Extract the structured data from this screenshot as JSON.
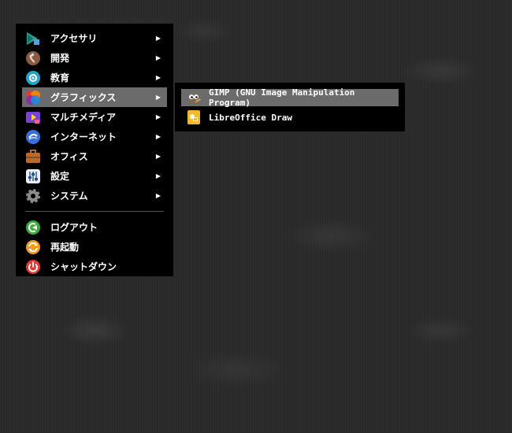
{
  "menu": {
    "items": [
      {
        "label": "アクセサリ",
        "icon": "accessories-icon",
        "has_submenu": true
      },
      {
        "label": "開発",
        "icon": "development-icon",
        "has_submenu": true
      },
      {
        "label": "教育",
        "icon": "education-icon",
        "has_submenu": true
      },
      {
        "label": "グラフィックス",
        "icon": "graphics-icon",
        "has_submenu": true,
        "active": true
      },
      {
        "label": "マルチメディア",
        "icon": "multimedia-icon",
        "has_submenu": true
      },
      {
        "label": "インターネット",
        "icon": "internet-icon",
        "has_submenu": true
      },
      {
        "label": "オフィス",
        "icon": "office-icon",
        "has_submenu": true
      },
      {
        "label": "設定",
        "icon": "settings-icon",
        "has_submenu": true
      },
      {
        "label": "システム",
        "icon": "system-icon",
        "has_submenu": true
      }
    ],
    "actions": [
      {
        "label": "ログアウト",
        "icon": "logout-icon",
        "color": "#3cab3c"
      },
      {
        "label": "再起動",
        "icon": "reboot-icon",
        "color": "#f29b1d"
      },
      {
        "label": "シャットダウン",
        "icon": "shutdown-icon",
        "color": "#e53935"
      }
    ],
    "arrow": "▶"
  },
  "submenu": {
    "items": [
      {
        "label": "GIMP (GNU Image Manipulation Program)",
        "icon": "gimp-icon",
        "active": true
      },
      {
        "label": "LibreOffice Draw",
        "icon": "libreoffice-draw-icon"
      }
    ]
  },
  "colors": {
    "menu_bg": "#000000",
    "highlight": "#6b6b6b",
    "text": "#ffffff"
  }
}
